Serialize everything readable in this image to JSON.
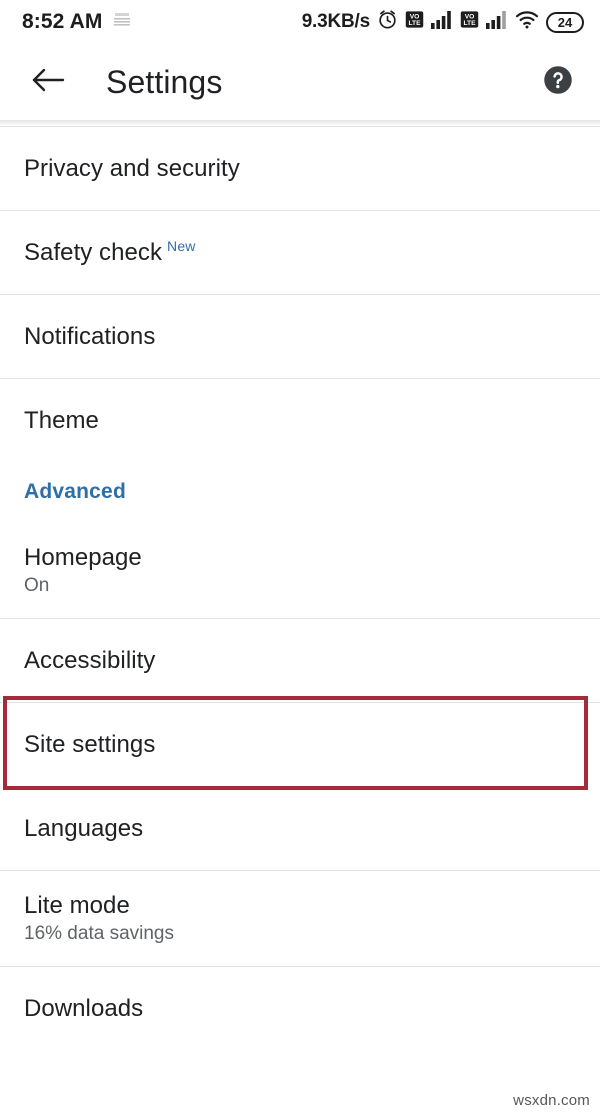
{
  "status_bar": {
    "clock": "8:52 AM",
    "left_icon": "sim-card-icon",
    "network_speed": "9.3KB/s",
    "icons": [
      "alarm-clock-icon",
      "volte-sim1-icon",
      "signal-bars-sim1-icon",
      "volte-sim2-icon",
      "signal-bars-sim2-icon",
      "wifi-icon"
    ],
    "battery_level": "24"
  },
  "toolbar": {
    "back_icon": "back-arrow-icon",
    "title": "Settings",
    "help_icon": "help-circle-icon"
  },
  "settings": {
    "items": [
      {
        "label": "Privacy and security",
        "subtitle": "",
        "badge": "",
        "highlighted": false
      },
      {
        "label": "Safety check",
        "subtitle": "",
        "badge": "New",
        "highlighted": false
      },
      {
        "label": "Notifications",
        "subtitle": "",
        "badge": "",
        "highlighted": false
      },
      {
        "label": "Theme",
        "subtitle": "",
        "badge": "",
        "highlighted": false
      },
      {
        "label": "Homepage",
        "subtitle": "On",
        "badge": "",
        "highlighted": false
      },
      {
        "label": "Accessibility",
        "subtitle": "",
        "badge": "",
        "highlighted": false
      },
      {
        "label": "Site settings",
        "subtitle": "",
        "badge": "",
        "highlighted": true
      },
      {
        "label": "Languages",
        "subtitle": "",
        "badge": "",
        "highlighted": false
      },
      {
        "label": "Lite mode",
        "subtitle": "16% data savings",
        "badge": "",
        "highlighted": false
      },
      {
        "label": "Downloads",
        "subtitle": "",
        "badge": "",
        "highlighted": false
      }
    ],
    "section_header": "Advanced"
  },
  "highlight": {
    "color": "#a52a3a",
    "target": "Site settings"
  },
  "watermark": "wsxdn.com"
}
